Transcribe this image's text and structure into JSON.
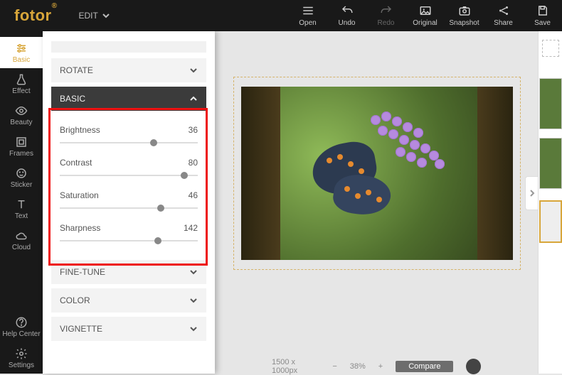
{
  "brand": "fotor",
  "mode": {
    "label": "EDIT"
  },
  "top_actions": {
    "open": "Open",
    "undo": "Undo",
    "redo": "Redo",
    "original": "Original",
    "snapshot": "Snapshot",
    "share": "Share",
    "save": "Save"
  },
  "rail": {
    "basic": "Basic",
    "effect": "Effect",
    "beauty": "Beauty",
    "frames": "Frames",
    "sticker": "Sticker",
    "text": "Text",
    "cloud": "Cloud",
    "help": "Help Center",
    "settings": "Settings"
  },
  "sections": {
    "rotate": "ROTATE",
    "basic": "BASIC",
    "fine_tune": "FINE-TUNE",
    "color": "COLOR",
    "vignette": "VIGNETTE"
  },
  "sliders": {
    "brightness": {
      "label": "Brightness",
      "value": 36,
      "min": -100,
      "max": 100
    },
    "contrast": {
      "label": "Contrast",
      "value": 80,
      "min": -100,
      "max": 100
    },
    "saturation": {
      "label": "Saturation",
      "value": 46,
      "min": -100,
      "max": 100
    },
    "sharpness": {
      "label": "Sharpness",
      "value": 142,
      "min": 0,
      "max": 200
    }
  },
  "bottom": {
    "dims": "1500 x 1000px",
    "zoom": "38%",
    "compare": "Compare"
  }
}
